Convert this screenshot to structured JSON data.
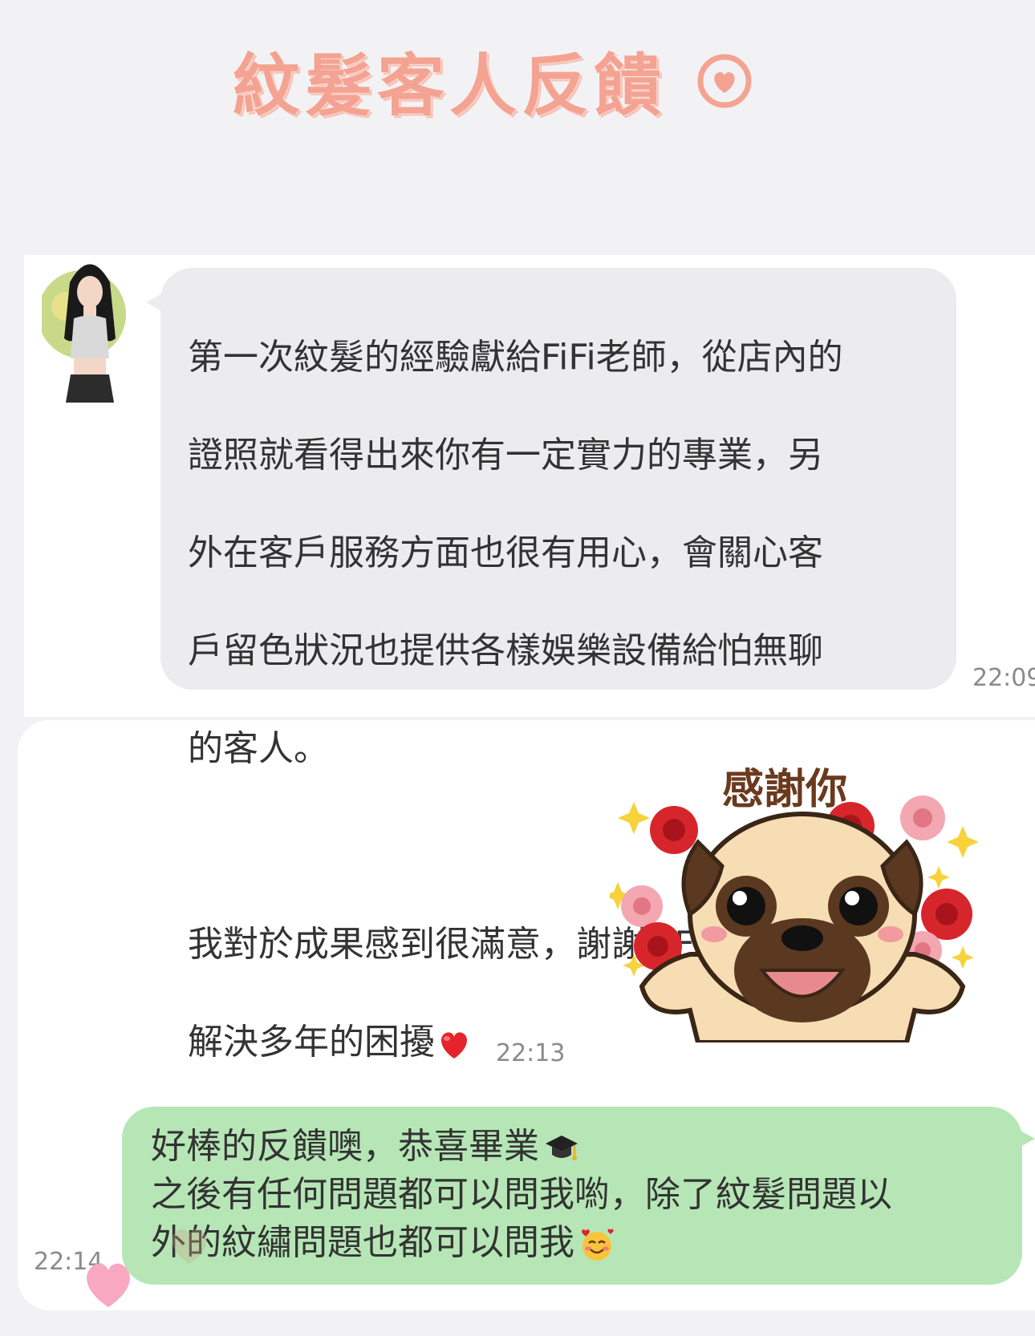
{
  "header": {
    "title": "紋髮客人反饋",
    "accent_color": "#f4a392",
    "heart_icon": "heart-outline-icon"
  },
  "chat": {
    "incoming": {
      "avatar_icon": "contact-avatar",
      "lines": [
        "第一次紋髮的經驗獻給FiFi老師，從店內的",
        "證照就看得出來你有一定實力的專業，另",
        "外在客戶服務方面也很有用心，會關心客",
        "戶留色狀況也提供各樣娛樂設備給怕無聊",
        "的客人。",
        "",
        "我對於成果感到很滿意，謝謝FiFi老師幫我",
        "解決多年的困擾"
      ],
      "trailing_emoji": "red-heart-emoji",
      "time": "22:09",
      "bubble_color": "#ececef"
    },
    "sticker": {
      "caption": "感謝你",
      "icon": "pug-thank-you-sticker",
      "time": "22:13"
    },
    "outgoing": {
      "lines": [
        "好棒的反饋噢，恭喜畢業",
        "之後有任何問題都可以問我喲，除了紋髮問題以",
        "外的紋繡問題也都可以問我"
      ],
      "line1_emoji": "graduation-cap-emoji",
      "line3_emoji": "smiling-face-with-hearts-emoji",
      "time": "22:14",
      "bubble_color": "#b6e6b6"
    }
  },
  "overlay": {
    "heart_icon": "pink-heart-icon",
    "heart_color": "#f8a8c0"
  }
}
